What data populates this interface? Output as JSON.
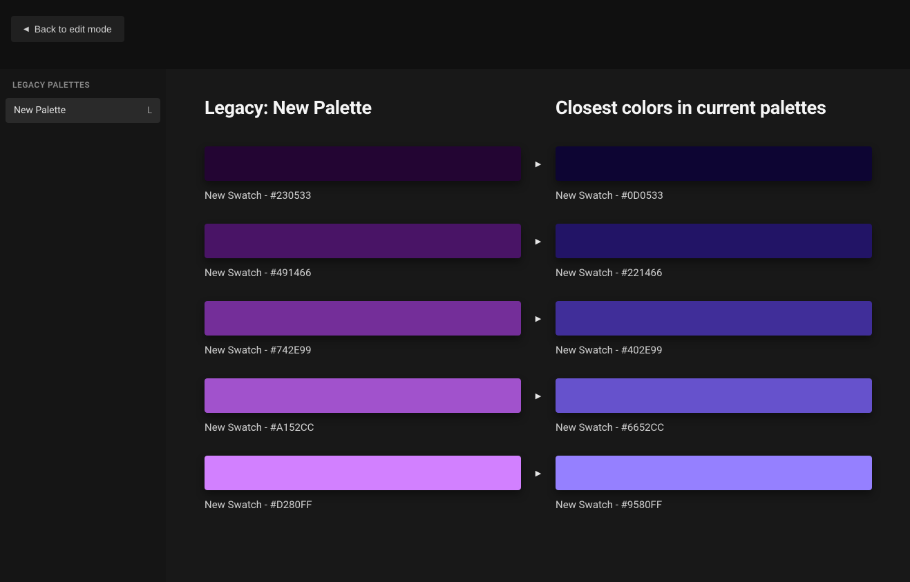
{
  "header": {
    "back_label": "Back to edit mode"
  },
  "sidebar": {
    "heading": "LEGACY PALETTES",
    "items": [
      {
        "label": "New Palette",
        "badge": "L"
      }
    ]
  },
  "main": {
    "legacy_title": "Legacy: New Palette",
    "closest_title": "Closest colors in current palettes",
    "rows": [
      {
        "legacy": {
          "label": "New Swatch - #230533",
          "hex": "#230533"
        },
        "closest": {
          "label": "New Swatch - #0D0533",
          "hex": "#0D0533"
        }
      },
      {
        "legacy": {
          "label": "New Swatch - #491466",
          "hex": "#491466"
        },
        "closest": {
          "label": "New Swatch - #221466",
          "hex": "#221466"
        }
      },
      {
        "legacy": {
          "label": "New Swatch - #742E99",
          "hex": "#742E99"
        },
        "closest": {
          "label": "New Swatch - #402E99",
          "hex": "#402E99"
        }
      },
      {
        "legacy": {
          "label": "New Swatch - #A152CC",
          "hex": "#A152CC"
        },
        "closest": {
          "label": "New Swatch - #6652CC",
          "hex": "#6652CC"
        }
      },
      {
        "legacy": {
          "label": "New Swatch - #D280FF",
          "hex": "#D280FF"
        },
        "closest": {
          "label": "New Swatch - #9580FF",
          "hex": "#9580FF"
        }
      }
    ]
  }
}
